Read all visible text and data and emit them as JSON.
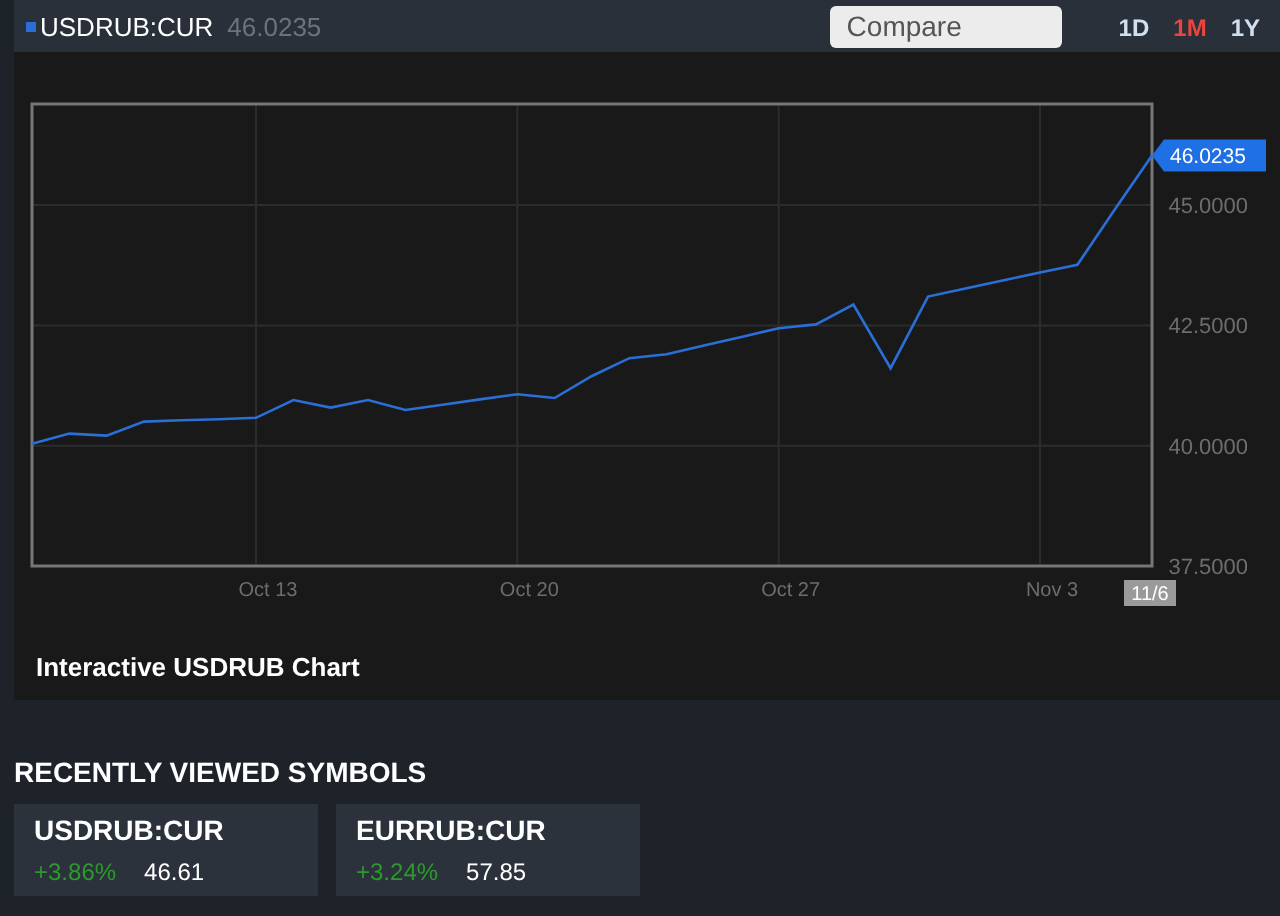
{
  "header": {
    "price": "46.0235",
    "compare": {
      "placeholder": "Compare"
    },
    "ranges": [
      {
        "label": "1D",
        "selected": false
      },
      {
        "label": "1M",
        "selected": true
      },
      {
        "label": "1Y",
        "selected": false
      }
    ]
  },
  "chart": {
    "title": "Interactive USDRUB Chart",
    "last_value_tag": "46.0235",
    "last_date_tag": "11/6",
    "chart_data": {
      "type": "line",
      "categories": [
        null,
        null,
        null,
        null,
        null,
        null,
        "Oct 13",
        null,
        null,
        null,
        null,
        null,
        null,
        "Oct 20",
        null,
        null,
        null,
        null,
        null,
        null,
        "Oct 27",
        null,
        null,
        null,
        null,
        null,
        null,
        "Nov 3",
        null,
        null,
        null
      ],
      "series": [
        {
          "name": "USDRUB:CUR",
          "color": "#2a6fd6",
          "values": [
            40.04,
            40.25,
            40.21,
            40.5,
            40.53,
            40.55,
            40.58,
            40.95,
            40.79,
            40.95,
            40.74,
            40.85,
            40.96,
            41.07,
            40.99,
            41.45,
            41.82,
            41.9,
            42.08,
            42.26,
            42.44,
            42.52,
            42.93,
            41.61,
            43.1,
            43.27,
            43.43,
            43.6,
            43.76,
            44.9,
            46.03
          ]
        }
      ],
      "ylim": [
        37.5,
        47.1
      ],
      "grid": true,
      "yticks": [
        {
          "value": 37.5,
          "label": "37.5000"
        },
        {
          "value": 40,
          "label": "40.0000"
        },
        {
          "value": 42.5,
          "label": "42.5000"
        },
        {
          "value": 45,
          "label": "45.0000"
        }
      ]
    }
  },
  "recently_viewed": {
    "title": "RECENTLY VIEWED SYMBOLS",
    "symbols": [
      {
        "symbol": "USDRUB:CUR",
        "change": "+3.86%",
        "price": "46.61"
      },
      {
        "symbol": "EURRUB:CUR",
        "change": "+3.24%",
        "price": "57.85"
      }
    ]
  }
}
